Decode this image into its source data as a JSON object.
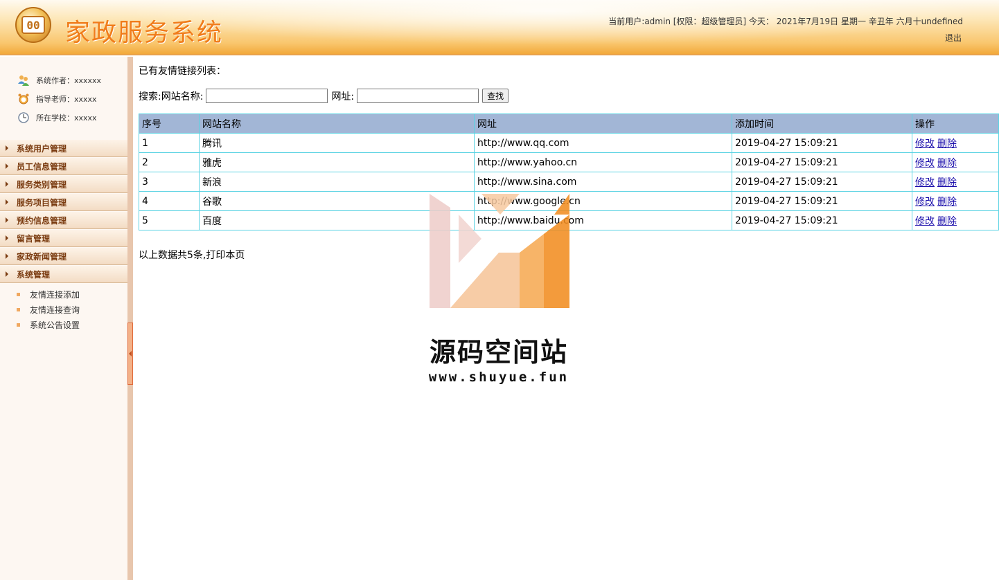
{
  "header": {
    "logo_text": "00",
    "title": "家政服务系统",
    "user_info": "当前用户:admin [权限：超级管理员] 今天： 2021年7月19日 星期一 辛丑年 六月十undefined",
    "logout": "退出"
  },
  "sidebar": {
    "info": [
      {
        "label": "系统作者：xxxxxx",
        "icon": "users-icon"
      },
      {
        "label": "指导老师：xxxxx",
        "icon": "alarm-clock-icon"
      },
      {
        "label": "所在学校：xxxxx",
        "icon": "clock-icon"
      }
    ],
    "menu": [
      "系统用户管理",
      "员工信息管理",
      "服务类别管理",
      "服务项目管理",
      "预约信息管理",
      "留言管理",
      "家政新闻管理",
      "系统管理"
    ],
    "submenu": [
      "友情连接添加",
      "友情连接查询",
      "系统公告设置"
    ]
  },
  "main": {
    "list_title": "已有友情链接列表：",
    "search": {
      "name_label": "搜索:网站名称:",
      "name_value": "",
      "url_label": "网址:",
      "url_value": "",
      "button": "查找"
    },
    "table": {
      "headers": [
        "序号",
        "网站名称",
        "网址",
        "添加时间",
        "操作"
      ],
      "rows": [
        {
          "no": "1",
          "name": "腾讯",
          "url": "http://www.qq.com",
          "time": "2019-04-27 15:09:21"
        },
        {
          "no": "2",
          "name": "雅虎",
          "url": "http://www.yahoo.cn",
          "time": "2019-04-27 15:09:21"
        },
        {
          "no": "3",
          "name": "新浪",
          "url": "http://www.sina.com",
          "time": "2019-04-27 15:09:21"
        },
        {
          "no": "4",
          "name": "谷歌",
          "url": "http://www.google.cn",
          "time": "2019-04-27 15:09:21"
        },
        {
          "no": "5",
          "name": "百度",
          "url": "http://www.baidu.com",
          "time": "2019-04-27 15:09:21"
        }
      ],
      "edit_label": "修改",
      "delete_label": "删除"
    },
    "summary": "以上数据共5条,打印本页"
  },
  "watermark": {
    "text": "源码空间站",
    "url": "www.shuyue.fun"
  },
  "colors": {
    "table_header": "#a2b6d6",
    "table_border": "#5bd3e3",
    "title": "#f07c1a",
    "menu_text": "#7a3b10"
  }
}
